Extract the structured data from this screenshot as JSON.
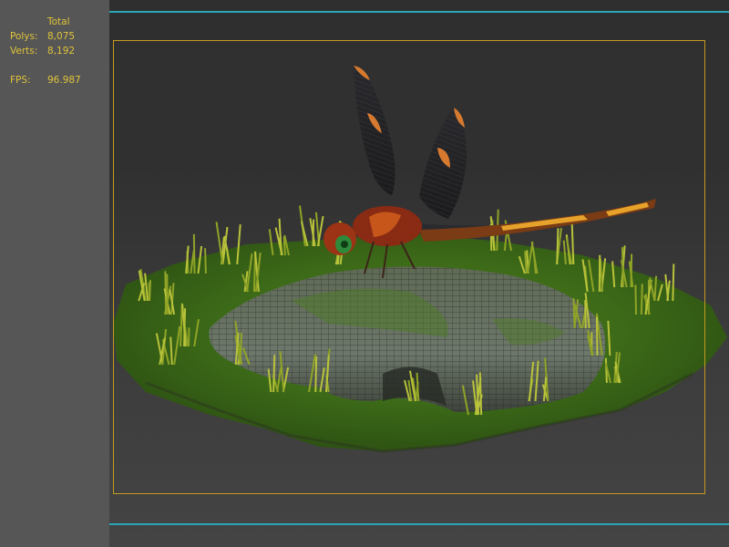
{
  "stats": {
    "header": "Total",
    "polys_label": "Polys:",
    "polys_value": "8,075",
    "verts_label": "Verts:",
    "verts_value": "8,192",
    "fps_label": "FPS:",
    "fps_value": "96.987",
    "text_color": "#e0c33a"
  },
  "viewport": {
    "guide_color": "#2aa7b6",
    "frame_color": "#c49a1f",
    "scene_objects": [
      "mossy-ground-plane",
      "rock",
      "grass-clumps",
      "dragonfly"
    ]
  }
}
